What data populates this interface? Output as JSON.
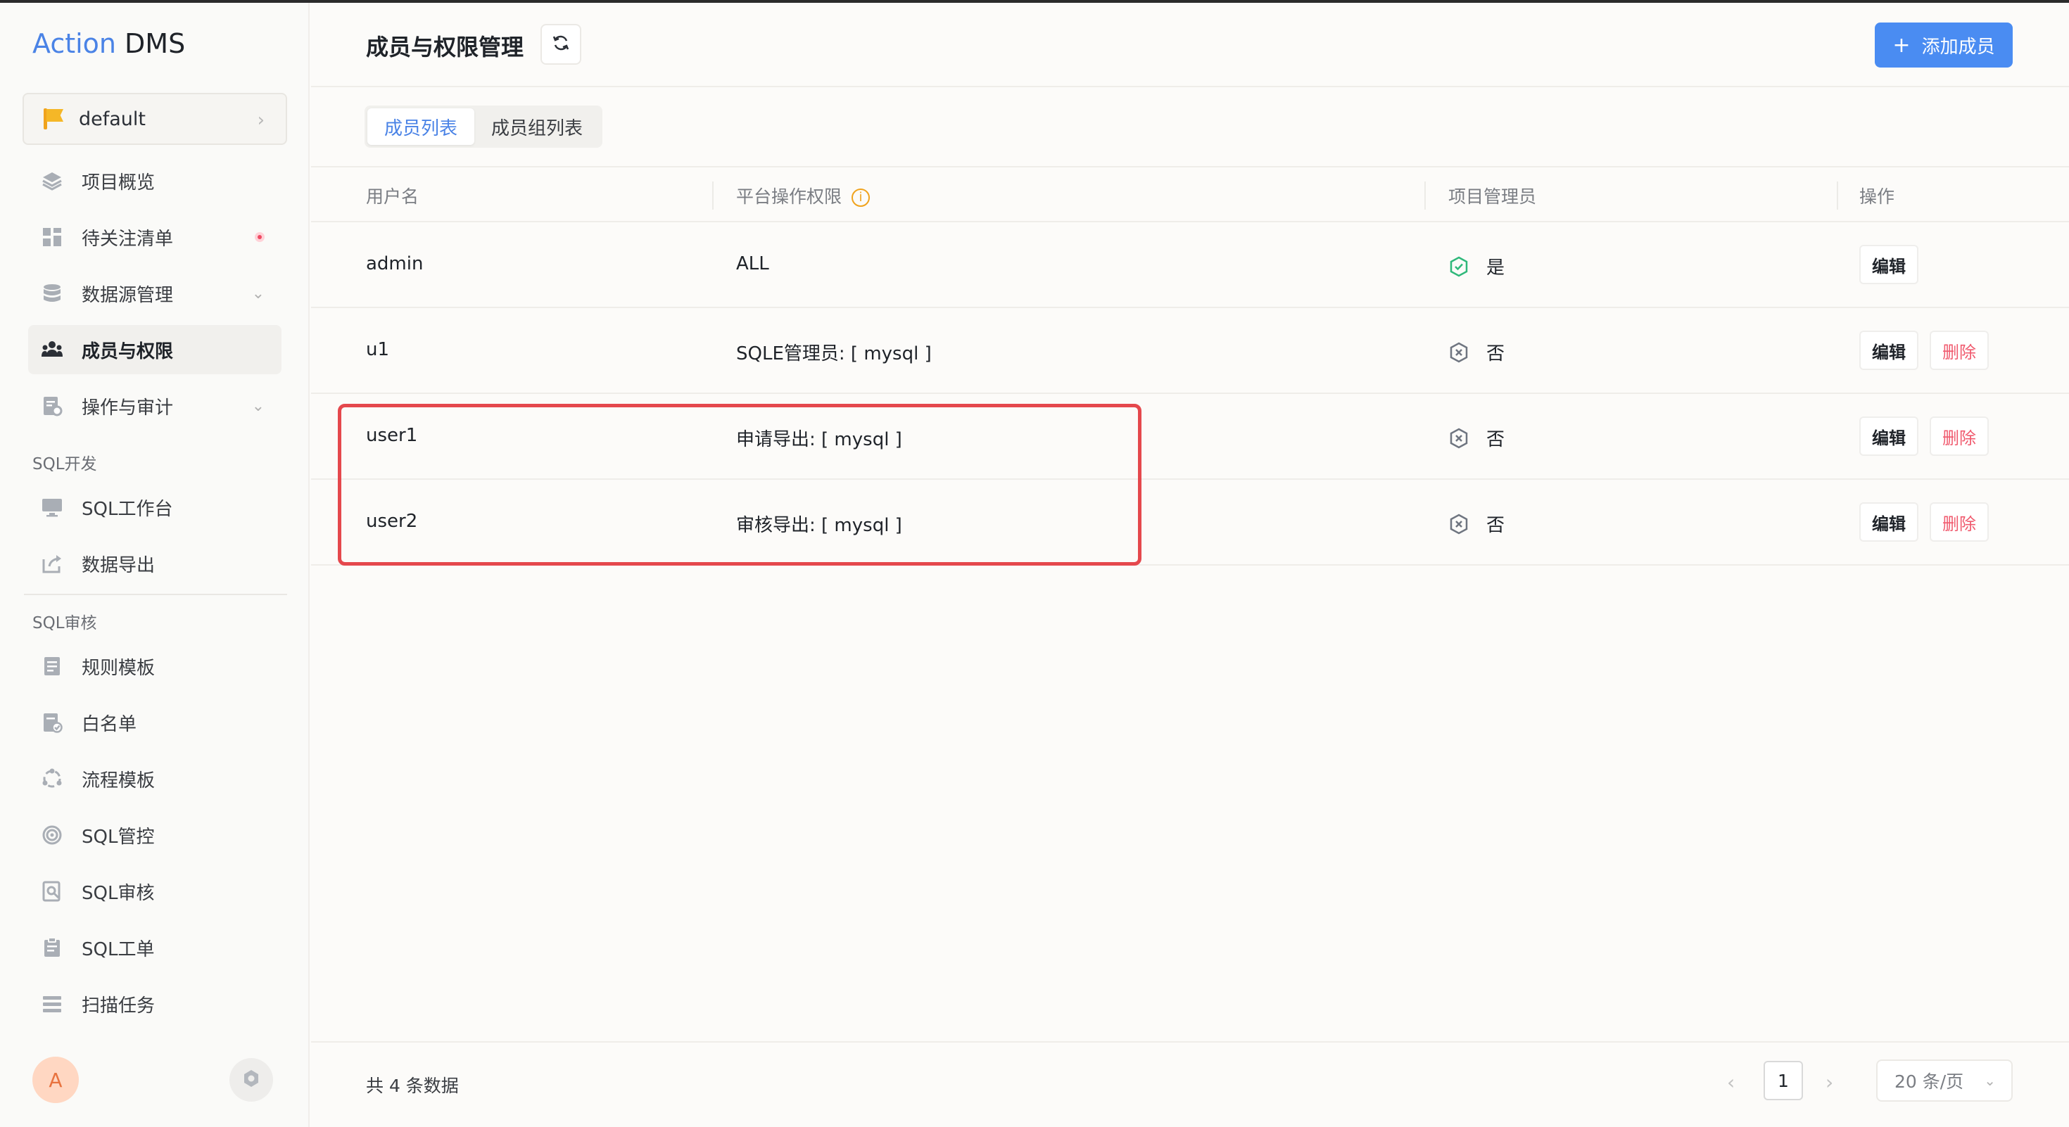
{
  "app": {
    "brand": "Action",
    "name": "DMS"
  },
  "project": {
    "name": "default"
  },
  "sidebar": {
    "items": [
      {
        "label": "项目概览",
        "icon": "layers-icon"
      },
      {
        "label": "待关注清单",
        "icon": "dashboard-icon"
      },
      {
        "label": "数据源管理",
        "icon": "database-icon"
      },
      {
        "label": "成员与权限",
        "icon": "members-icon"
      },
      {
        "label": "操作与审计",
        "icon": "audit-icon"
      }
    ],
    "sql_dev": {
      "title": "SQL开发",
      "items": [
        {
          "label": "SQL工作台",
          "icon": "monitor-icon"
        },
        {
          "label": "数据导出",
          "icon": "export-icon"
        }
      ]
    },
    "sql_audit": {
      "title": "SQL审核",
      "items": [
        {
          "label": "规则模板",
          "icon": "rule-template-icon"
        },
        {
          "label": "白名单",
          "icon": "whitelist-icon"
        },
        {
          "label": "流程模板",
          "icon": "workflow-template-icon"
        },
        {
          "label": "SQL管控",
          "icon": "sql-control-icon"
        },
        {
          "label": "SQL审核",
          "icon": "sql-audit-icon"
        },
        {
          "label": "SQL工单",
          "icon": "sql-ticket-icon"
        },
        {
          "label": "扫描任务",
          "icon": "scan-task-icon"
        }
      ]
    },
    "avatar_letter": "A"
  },
  "header": {
    "title": "成员与权限管理",
    "add_button": "添加成员"
  },
  "tabs": [
    {
      "label": "成员列表"
    },
    {
      "label": "成员组列表"
    }
  ],
  "table": {
    "columns": [
      "用户名",
      "平台操作权限",
      "项目管理员",
      "操作"
    ],
    "info_glyph": "i",
    "rows": [
      {
        "username": "admin",
        "permission": "ALL",
        "is_admin": "是",
        "edit": "编辑",
        "delete": ""
      },
      {
        "username": "u1",
        "permission": "SQLE管理员: [ mysql ]",
        "is_admin": "否",
        "edit": "编辑",
        "delete": "删除"
      },
      {
        "username": "user1",
        "permission": "申请导出: [ mysql ]",
        "is_admin": "否",
        "edit": "编辑",
        "delete": "删除"
      },
      {
        "username": "user2",
        "permission": "审核导出: [ mysql ]",
        "is_admin": "否",
        "edit": "编辑",
        "delete": "删除"
      }
    ]
  },
  "footer": {
    "total": "共 4 条数据",
    "page": "1",
    "page_size": "20 条/页"
  },
  "colors": {
    "accent": "#4a8cf2",
    "danger": "#f05a6e",
    "success": "#2fb87a",
    "highlight": "#e5484d"
  }
}
